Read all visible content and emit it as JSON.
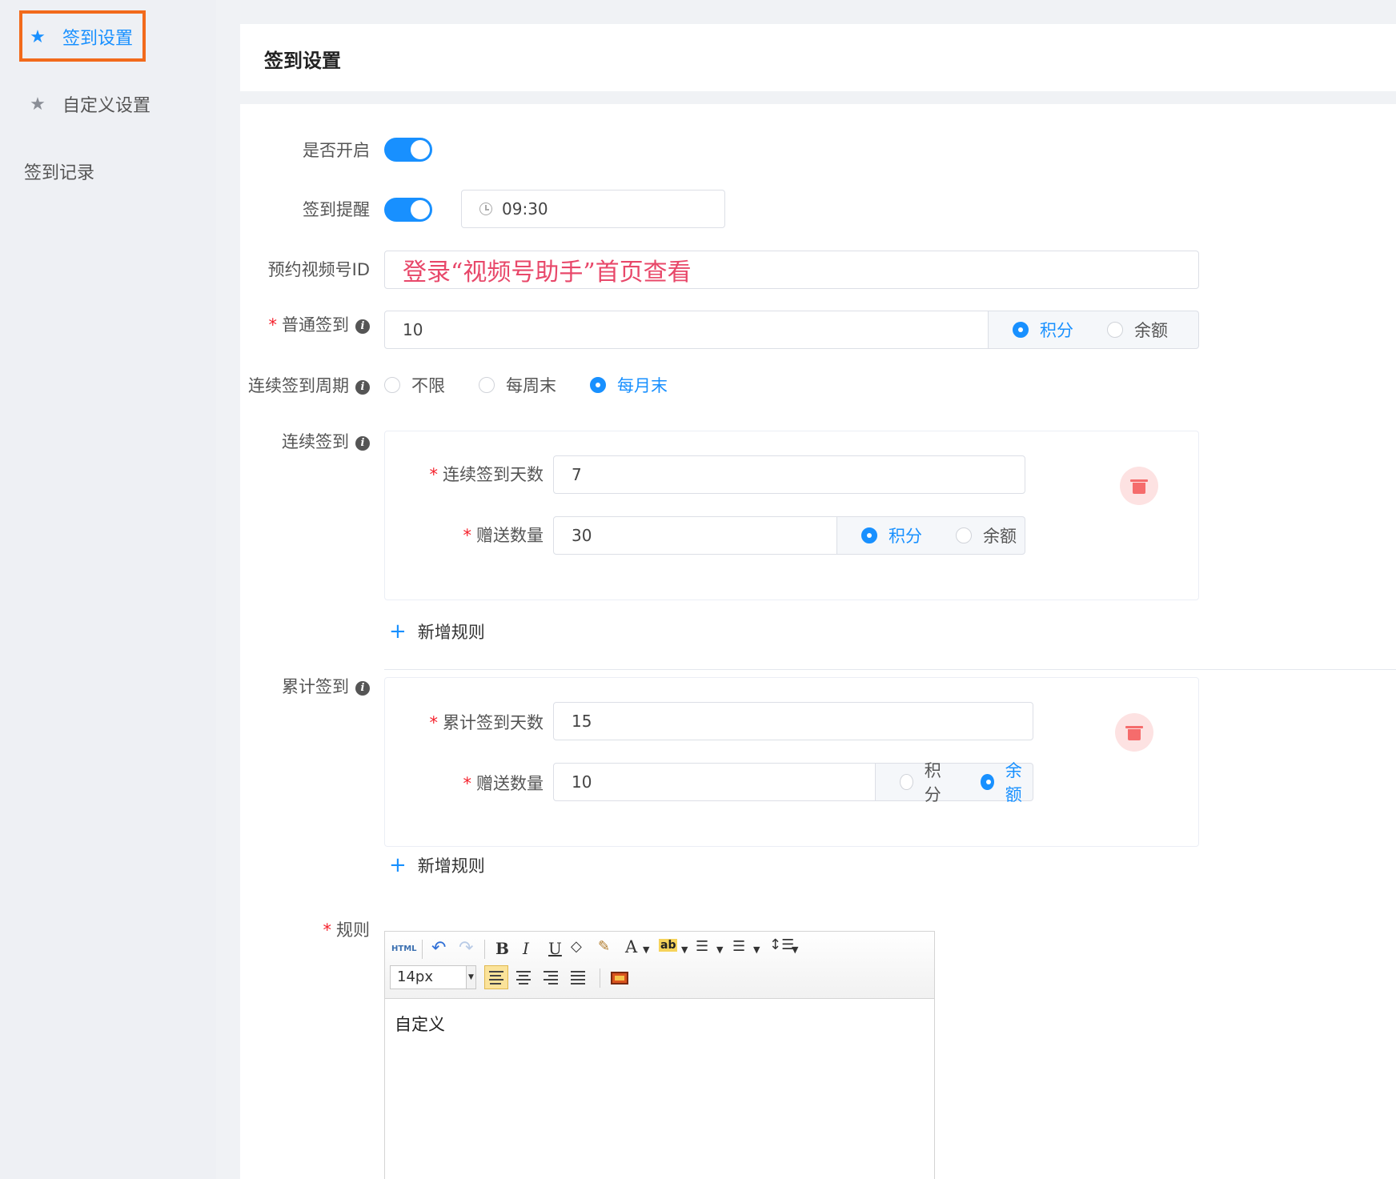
{
  "sidebar": {
    "items": [
      {
        "label": "签到设置",
        "icon": "star-icon",
        "active": true
      },
      {
        "label": "自定义设置",
        "icon": "star-icon",
        "active": false
      },
      {
        "label": "签到记录",
        "icon": "",
        "active": false
      }
    ]
  },
  "header": {
    "title": "签到设置"
  },
  "form": {
    "enable": {
      "label": "是否开启",
      "value": true
    },
    "reminder": {
      "label": "签到提醒",
      "value": true,
      "time": "09:30"
    },
    "channel_id": {
      "label": "预约视频号ID",
      "placeholder": "登录“视频号助手”首页查看"
    },
    "normal_signin": {
      "label": "普通签到",
      "required": true,
      "value": "10",
      "options": [
        "积分",
        "余额"
      ],
      "selected": "积分"
    },
    "cycle": {
      "label": "连续签到周期",
      "options": [
        "不限",
        "每周末",
        "每月末"
      ],
      "selected": "每月末"
    },
    "continuous": {
      "label": "连续签到",
      "days_label": "连续签到天数",
      "days": "7",
      "amount_label": "赠送数量",
      "amount": "30",
      "options": [
        "积分",
        "余额"
      ],
      "selected": "积分",
      "add_label": "新增规则"
    },
    "cumulative": {
      "label": "累计签到",
      "days_label": "累计签到天数",
      "days": "15",
      "amount_label": "赠送数量",
      "amount": "10",
      "options": [
        "积分",
        "余额"
      ],
      "selected": "余额",
      "add_label": "新增规则"
    },
    "rules": {
      "label": "规则",
      "required": true,
      "font_size": "14px",
      "content": "自定义"
    }
  },
  "colors": {
    "accent": "#1890ff",
    "required": "#f5222d",
    "highlight_border": "#f26a1b",
    "delete": "#f56c6c",
    "placeholder_red": "#e8486a"
  }
}
